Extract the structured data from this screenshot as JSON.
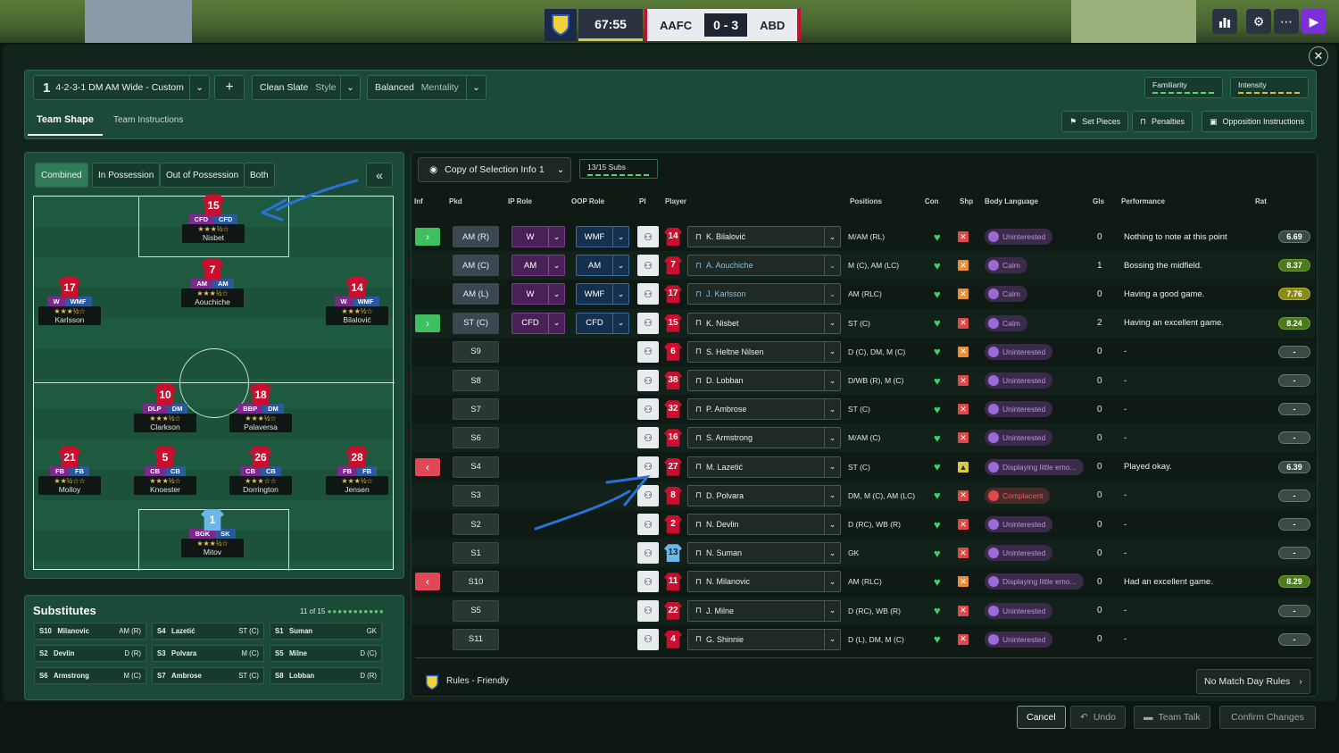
{
  "match": {
    "time": "67:55",
    "home": "AAFC",
    "score": "0 - 3",
    "away": "ABD"
  },
  "top_icons": [
    "bar-chart-icon",
    "gear-icon",
    "more-icon",
    "play-icon"
  ],
  "tactic": {
    "formation": "4-2-3-1 DM AM Wide - Custom",
    "formation_num": "1",
    "style_value": "Clean Slate",
    "style_label": "Style",
    "mentality_value": "Balanced",
    "mentality_label": "Mentality",
    "familiarity": "Familiarity",
    "intensity": "Intensity",
    "tabs": [
      "Team Shape",
      "Team Instructions"
    ],
    "set_pieces": "Set Pieces",
    "penalties": "Penalties",
    "opposition": "Opposition Instructions"
  },
  "pitch": {
    "views": [
      "Combined",
      "In Possession",
      "Out of Possession",
      "Both"
    ],
    "players": [
      {
        "num": "15",
        "r1": "CFD",
        "r2": "CFD",
        "name": "Nisbet",
        "stars": "★★★½☆"
      },
      {
        "num": "17",
        "r1": "W",
        "r2": "WMF",
        "name": "Karlsson",
        "stars": "★★★½☆"
      },
      {
        "num": "7",
        "r1": "AM",
        "r2": "AM",
        "name": "Aouchiche",
        "stars": "★★★½☆"
      },
      {
        "num": "14",
        "r1": "W",
        "r2": "WMF",
        "name": "Bilalović",
        "stars": "★★★½☆"
      },
      {
        "num": "10",
        "r1": "DLP",
        "r2": "DM",
        "name": "Clarkson",
        "stars": "★★★½☆"
      },
      {
        "num": "18",
        "r1": "BBP",
        "r2": "DM",
        "name": "Palaversa",
        "stars": "★★★½☆"
      },
      {
        "num": "21",
        "r1": "FB",
        "r2": "FB",
        "name": "Molloy",
        "stars": "★★½☆☆"
      },
      {
        "num": "5",
        "r1": "CB",
        "r2": "CB",
        "name": "Knoester",
        "stars": "★★★½☆"
      },
      {
        "num": "26",
        "r1": "CB",
        "r2": "CB",
        "name": "Dorrington",
        "stars": "★★★☆☆"
      },
      {
        "num": "28",
        "r1": "FB",
        "r2": "FB",
        "name": "Jensen",
        "stars": "★★★½☆"
      },
      {
        "num": "1",
        "r1": "BGK",
        "r2": "SK",
        "name": "Mitov",
        "stars": "★★★½☆"
      }
    ]
  },
  "subs": {
    "title": "Substitutes",
    "count": "11 of 15",
    "items": [
      {
        "slot": "S10",
        "name": "Milanovic",
        "pos": "AM (R)"
      },
      {
        "slot": "S4",
        "name": "Lazetić",
        "pos": "ST (C)"
      },
      {
        "slot": "S1",
        "name": "Suman",
        "pos": "GK"
      },
      {
        "slot": "S2",
        "name": "Devlin",
        "pos": "D (R)"
      },
      {
        "slot": "S3",
        "name": "Polvara",
        "pos": "M (C)"
      },
      {
        "slot": "S5",
        "name": "Milne",
        "pos": "D (C)"
      },
      {
        "slot": "S6",
        "name": "Armstrong",
        "pos": "M (C)"
      },
      {
        "slot": "S7",
        "name": "Ambrose",
        "pos": "ST (C)"
      },
      {
        "slot": "S8",
        "name": "Lobban",
        "pos": "D (R)"
      }
    ]
  },
  "table": {
    "view": "Copy of Selection Info 1",
    "subs_count": "13/15 Subs",
    "headers": [
      "Inf",
      "Pkd",
      "IP Role",
      "OOP Role",
      "PI",
      "Player",
      "Positions",
      "Con",
      "Shp",
      "Body Language",
      "Gls",
      "Performance",
      "Rat"
    ],
    "rows": [
      {
        "inf": "in",
        "pkd": "AM (R)",
        "ip": "W",
        "oop": "WMF",
        "num": "14",
        "player": "K. Bilalović",
        "hl": false,
        "pos": "M/AM (RL)",
        "shp": "x",
        "bl": "Uninterested",
        "gls": "0",
        "perf": "Nothing to note at this point",
        "rat": "6.69",
        "ratc": ""
      },
      {
        "inf": "",
        "pkd": "AM (C)",
        "ip": "AM",
        "oop": "AM",
        "num": "7",
        "player": "A. Aouchiche",
        "hl": true,
        "pos": "M (C), AM (LC)",
        "shp": "w",
        "bl": "Calm",
        "gls": "1",
        "perf": "Bossing the midfield.",
        "rat": "8.37",
        "ratc": "g"
      },
      {
        "inf": "",
        "pkd": "AM (L)",
        "ip": "W",
        "oop": "WMF",
        "num": "17",
        "player": "J. Karlsson",
        "hl": true,
        "pos": "AM (RLC)",
        "shp": "w",
        "bl": "Calm",
        "gls": "0",
        "perf": "Having a good game.",
        "rat": "7.76",
        "ratc": "y"
      },
      {
        "inf": "in",
        "pkd": "ST (C)",
        "ip": "CFD",
        "oop": "CFD",
        "num": "15",
        "player": "K. Nisbet",
        "hl": false,
        "pos": "ST (C)",
        "shp": "x",
        "bl": "Calm",
        "gls": "2",
        "perf": "Having an excellent game.",
        "rat": "8.24",
        "ratc": "g"
      },
      {
        "inf": "",
        "pkd": "S9",
        "ip": "",
        "oop": "",
        "num": "6",
        "player": "S. Heltne Nilsen",
        "hl": false,
        "pos": "D (C), DM, M (C)",
        "shp": "w",
        "bl": "Uninterested",
        "gls": "0",
        "perf": "-",
        "rat": "-",
        "ratc": ""
      },
      {
        "inf": "",
        "pkd": "S8",
        "ip": "",
        "oop": "",
        "num": "38",
        "player": "D. Lobban",
        "hl": false,
        "pos": "D/WB (R), M (C)",
        "shp": "x",
        "bl": "Uninterested",
        "gls": "0",
        "perf": "-",
        "rat": "-",
        "ratc": ""
      },
      {
        "inf": "",
        "pkd": "S7",
        "ip": "",
        "oop": "",
        "num": "32",
        "player": "P. Ambrose",
        "hl": false,
        "pos": "ST (C)",
        "shp": "x",
        "bl": "Uninterested",
        "gls": "0",
        "perf": "-",
        "rat": "-",
        "ratc": ""
      },
      {
        "inf": "",
        "pkd": "S6",
        "ip": "",
        "oop": "",
        "num": "16",
        "player": "S. Armstrong",
        "hl": false,
        "pos": "M/AM (C)",
        "shp": "x",
        "bl": "Uninterested",
        "gls": "0",
        "perf": "-",
        "rat": "-",
        "ratc": ""
      },
      {
        "inf": "out",
        "pkd": "S4",
        "ip": "",
        "oop": "",
        "num": "27",
        "player": "M. Lazetić",
        "hl": false,
        "pos": "ST (C)",
        "shp": "u",
        "bl": "Displaying little emo...",
        "gls": "0",
        "perf": "Played okay.",
        "rat": "6.39",
        "ratc": ""
      },
      {
        "inf": "",
        "pkd": "S3",
        "ip": "",
        "oop": "",
        "num": "8",
        "player": "D. Polvara",
        "hl": false,
        "pos": "DM, M (C), AM (LC)",
        "shp": "x",
        "bl": "Complacent",
        "gls": "0",
        "perf": "-",
        "rat": "-",
        "ratc": ""
      },
      {
        "inf": "",
        "pkd": "S2",
        "ip": "",
        "oop": "",
        "num": "2",
        "player": "N. Devlin",
        "hl": false,
        "pos": "D (RC), WB (R)",
        "shp": "x",
        "bl": "Uninterested",
        "gls": "0",
        "perf": "-",
        "rat": "-",
        "ratc": ""
      },
      {
        "inf": "",
        "pkd": "S1",
        "ip": "",
        "oop": "",
        "num": "13",
        "player": "N. Suman",
        "hl": false,
        "pos": "GK",
        "shp": "x",
        "bl": "Uninterested",
        "gls": "0",
        "perf": "-",
        "rat": "-",
        "ratc": ""
      },
      {
        "inf": "out",
        "pkd": "S10",
        "ip": "",
        "oop": "",
        "num": "11",
        "player": "N. Milanovic",
        "hl": false,
        "pos": "AM (RLC)",
        "shp": "w",
        "bl": "Displaying little emo...",
        "gls": "0",
        "perf": "Had an excellent game.",
        "rat": "8.29",
        "ratc": "g"
      },
      {
        "inf": "",
        "pkd": "S5",
        "ip": "",
        "oop": "",
        "num": "22",
        "player": "J. Milne",
        "hl": false,
        "pos": "D (RC), WB (R)",
        "shp": "x",
        "bl": "Uninterested",
        "gls": "0",
        "perf": "-",
        "rat": "-",
        "ratc": ""
      },
      {
        "inf": "",
        "pkd": "S11",
        "ip": "",
        "oop": "",
        "num": "4",
        "player": "G. Shinnie",
        "hl": false,
        "pos": "D (L), DM, M (C)",
        "shp": "x",
        "bl": "Uninterested",
        "gls": "0",
        "perf": "-",
        "rat": "-",
        "ratc": ""
      }
    ],
    "rules": "Rules - Friendly",
    "no_match_rules": "No Match Day Rules"
  },
  "footer": {
    "cancel": "Cancel",
    "undo": "Undo",
    "team_talk": "Team Talk",
    "confirm": "Confirm Changes"
  }
}
